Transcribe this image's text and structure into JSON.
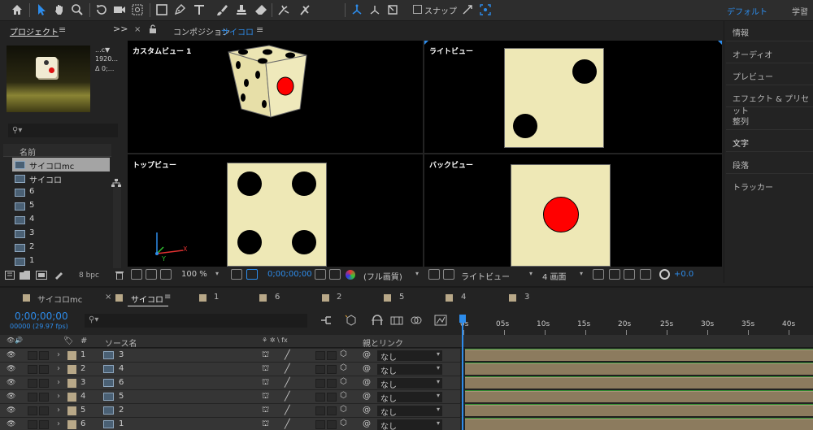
{
  "toolbar": {
    "snap_label": "スナップ",
    "workspace_default": "デフォルト",
    "workspace_learn": "学習"
  },
  "project": {
    "tab_label": "プロジェクト",
    "menu_glyph": "≡",
    "expand_glyph": ">>",
    "info_line1": "...c▼",
    "info_line2": "1920...",
    "info_line3": "Δ 0;...",
    "search_icon": "⚲▾",
    "column_name": "名前",
    "items": [
      {
        "label": "サイコロmc",
        "selected": true
      },
      {
        "label": "サイコロ",
        "selected": false
      },
      {
        "label": "6",
        "selected": false
      },
      {
        "label": "5",
        "selected": false
      },
      {
        "label": "4",
        "selected": false
      },
      {
        "label": "3",
        "selected": false
      },
      {
        "label": "2",
        "selected": false
      },
      {
        "label": "1",
        "selected": false
      }
    ],
    "bpc_label": "8 bpc"
  },
  "comp": {
    "close_glyph": "×",
    "lock_glyph": "🔓",
    "tab_prefix": "コンポジション",
    "tab_name": "サイコロ",
    "tab_menu": "≡",
    "views": [
      {
        "label": "カスタムビュー 1",
        "face_pips": "isometric die: 4 top, 5 front-left, red 1 front-right"
      },
      {
        "label": "ライトビュー",
        "pips": 2,
        "pip_color": "#000000"
      },
      {
        "label": "トップビュー",
        "pips": 4,
        "pip_color": "#000000"
      },
      {
        "label": "バックビュー",
        "pips": 1,
        "pip_color": "#ff0000"
      }
    ],
    "axis_x": "X",
    "axis_y": "Y",
    "viewer_toolbar": {
      "zoom": "100 %",
      "timecode": "0;00;00;00",
      "resolution": "(フル画質)",
      "view": "ライトビュー",
      "layout": "4 画面",
      "exposure": "+0.0"
    }
  },
  "right_panel": {
    "items": [
      "情報",
      "オーディオ",
      "プレビュー",
      "エフェクト & プリセット",
      "整列",
      "文字",
      "段落",
      "トラッカー"
    ]
  },
  "timeline_tabs": [
    {
      "label": "サイコロmc",
      "active": false
    },
    {
      "label": "サイコロ",
      "active": true,
      "close": "×",
      "menu": "≡"
    },
    {
      "label": "1",
      "active": false
    },
    {
      "label": "6",
      "active": false
    },
    {
      "label": "2",
      "active": false
    },
    {
      "label": "5",
      "active": false
    },
    {
      "label": "4",
      "active": false
    },
    {
      "label": "3",
      "active": false
    }
  ],
  "timeline": {
    "timecode": "0;00;00;00",
    "fps": "00000 (29.97 fps)",
    "search_icon": "⚲▾",
    "ruler_ticks": [
      "0s",
      "05s",
      "10s",
      "15s",
      "20s",
      "25s",
      "30s",
      "35s",
      "40s"
    ],
    "headers": {
      "hash": "#",
      "source_name": "ソース名",
      "parent_link": "親とリンク",
      "switches": "⚘ ✲ \\ fx"
    },
    "layers": [
      {
        "index": "1",
        "source": "3",
        "parent": "なし"
      },
      {
        "index": "2",
        "source": "4",
        "parent": "なし"
      },
      {
        "index": "3",
        "source": "6",
        "parent": "なし"
      },
      {
        "index": "4",
        "source": "5",
        "parent": "なし"
      },
      {
        "index": "5",
        "source": "2",
        "parent": "なし"
      },
      {
        "index": "6",
        "source": "1",
        "parent": "なし"
      }
    ],
    "layer_bar_color": "#8c7b5e"
  },
  "colors": {
    "accent": "#2d8ceb",
    "face": "#eee8b6",
    "pip_red": "#ff0000",
    "label_tan": "#b8a888"
  }
}
